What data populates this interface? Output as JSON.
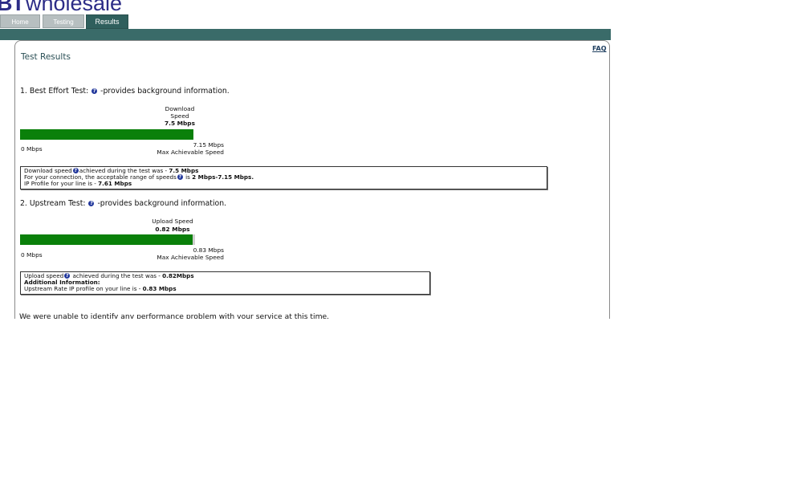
{
  "logo": {
    "bt": "BT",
    "wholesale": "wholesale"
  },
  "tabs": [
    {
      "label": "Home"
    },
    {
      "label": "Testing"
    },
    {
      "label": "Results"
    }
  ],
  "header": {
    "faq": "FAQ",
    "title": "Test Results"
  },
  "colors": {
    "brand": "#2c2c87",
    "strip": "#3a6b69",
    "progress": "#0a800a",
    "help_icon": "#22389c"
  },
  "download": {
    "heading_prefix": "1. Best Effort Test:",
    "heading_suffix": "-provides background information.",
    "metric_label_line1": "Download",
    "metric_label_line2": "Speed",
    "metric_value": "7.5 Mbps",
    "bar_fraction": 1.0,
    "min_label": "0 Mbps",
    "max_value": "7.15 Mbps",
    "max_label": "Max Achievable Speed",
    "info_line1_a": "Download speed",
    "info_line1_b": "achieved during the test was - ",
    "info_line1_value": "7.5 Mbps",
    "info_line2_a": "For your connection, the acceptable range of speeds",
    "info_line2_b": " is ",
    "info_line2_value": "2 Mbps-7.15 Mbps.",
    "info_line3_a": "IP Profile for your line is - ",
    "info_line3_value": "7.61 Mbps"
  },
  "upload": {
    "heading_prefix": "2. Upstream Test:",
    "heading_suffix": "-provides background information.",
    "metric_label": "Upload Speed",
    "metric_value": "0.82 Mbps",
    "bar_fraction": 0.988,
    "min_label": "0 Mbps",
    "max_value": "0.83 Mbps",
    "max_label": "Max Achievable Speed",
    "info_line1_a": "Upload speed",
    "info_line1_b": " achieved during the test was - ",
    "info_line1_value": "0.82Mbps",
    "info_line2": "Additional Information:",
    "info_line3_a": "Upstream Rate IP profile on your line is - ",
    "info_line3_value": "0.83 Mbps"
  },
  "footer_message": "We were unable to identify any performance problem with your service at this time."
}
